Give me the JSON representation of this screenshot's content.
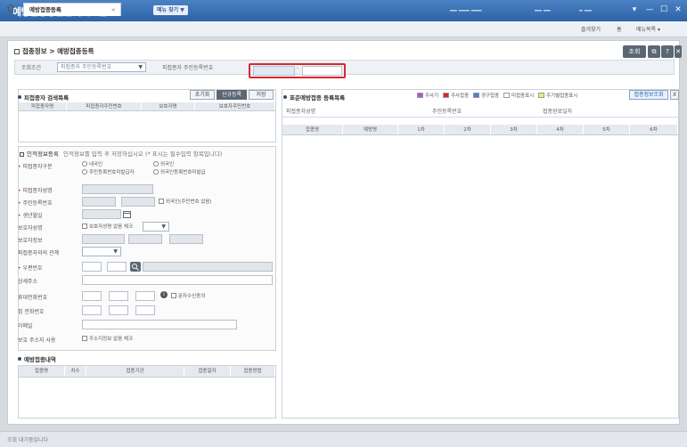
{
  "app": {
    "title": "예방접종통합관리시스템",
    "top_tab_label": "메뉴 찾기 ▼",
    "user_info": "━━ ━━━ ━━━",
    "dept_label": "━━ ━━",
    "sub_label": "━ ━━",
    "window_controls": [
      "▾",
      "—",
      "☐",
      "✕"
    ]
  },
  "tabs": [
    {
      "label": "예방접종등록",
      "close": "×"
    }
  ],
  "topright": {
    "fav": "즐겨찾기",
    "home": "홈",
    "menu": "메뉴목록 ▾"
  },
  "page": {
    "title": "접종정보 > 예방접종등록"
  },
  "page_buttons": {
    "search": "조회",
    "icon1": "⧉",
    "help": "?",
    "close": "✕"
  },
  "search_condition": {
    "label": "조회조건",
    "select_value": "피접종자 주민등록번호",
    "field_label": "피접종자 주민등록번호",
    "dash": "-"
  },
  "recipient_search": {
    "title": "피접종자 검색목록",
    "buttons": [
      "초기화",
      "신규등록",
      "저장"
    ],
    "columns": [
      "피접종자명",
      "피접종자주민번호",
      "보호자명",
      "보호자주민번호"
    ]
  },
  "recipient_form": {
    "title": "인적정보등록",
    "note": "인적정보를 입력 후 저장하십시오 (* 표시는 필수입력 항목입니다)",
    "fields": [
      {
        "label": "피접종자구분",
        "required": true,
        "options": [
          "내국인",
          "외국인",
          "주민등록번호미발급자",
          "외국인등록번호미발급"
        ]
      },
      {
        "label": "피접종자성명",
        "required": true
      },
      {
        "label": "주민등록번호",
        "required": true,
        "check": "외국인(주민번호 없음)"
      },
      {
        "label": "생년월일",
        "required": true
      },
      {
        "label": "보호자성명",
        "check": "보호자성명 없음 체크"
      },
      {
        "label": "보호자정보"
      },
      {
        "label": "피접종자와의 관계"
      },
      {
        "label": "우편번호",
        "required": true
      },
      {
        "label": "상세주소"
      },
      {
        "label": "휴대전화번호",
        "check": "문자수신동의"
      },
      {
        "label": "집 전화번호"
      },
      {
        "label": "이메일"
      },
      {
        "label": "보호 주소지 사용",
        "check": "주소지정보 없음 체크"
      }
    ]
  },
  "vaccination_history": {
    "title": "예방접종내역",
    "columns": [
      "접종명",
      "차수",
      "접종기관",
      "접종일자",
      "접종방법"
    ]
  },
  "right_panel": {
    "title": "표준예방접종 등록목록",
    "legend": [
      {
        "label": "주사기",
        "color": "#b94fd6"
      },
      {
        "label": "주사접종",
        "color": "#d9272e"
      },
      {
        "label": "경구접종",
        "color": "#4a7fd6"
      },
      {
        "label": "미접종표시",
        "color": "#ffffff"
      },
      {
        "label": "주기별접종표시",
        "color": "#f2e97a"
      }
    ],
    "buttons": [
      "접종정보조회",
      "X"
    ],
    "info_fields": [
      "피접종자성명",
      "주민등록번호",
      "접종완료일자"
    ],
    "columns": [
      "접종명",
      "예방명",
      "1차",
      "2차",
      "3차",
      "4차",
      "5차",
      "6차"
    ]
  },
  "status": {
    "text": "조회 대기중입니다"
  }
}
